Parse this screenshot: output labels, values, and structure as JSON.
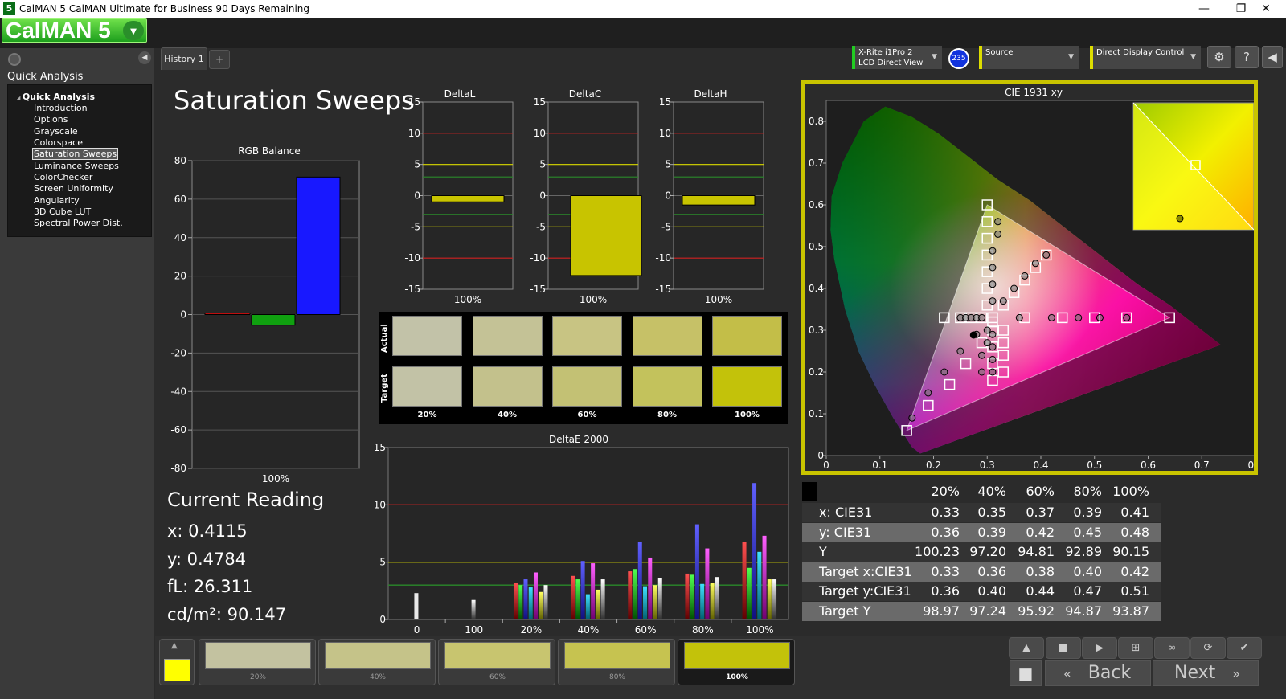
{
  "window": {
    "title": "CalMAN 5 CalMAN Ultimate for Business 90 Days Remaining",
    "app_icon": "5",
    "minimize_icon": "minimize-icon",
    "maximize_icon": "maximize-icon",
    "close_icon": "close-icon"
  },
  "logo": {
    "text": "CalMAN 5",
    "dropdown_glyph": "▾"
  },
  "left_panel": {
    "title": "Quick Analysis",
    "tree_root": "Quick Analysis",
    "items": [
      "Introduction",
      "Options",
      "Grayscale",
      "Colorspace",
      "Saturation Sweeps",
      "Luminance Sweeps",
      "ColorChecker",
      "Screen Uniformity",
      "Angularity",
      "3D Cube LUT",
      "Spectral Power Dist."
    ],
    "selected_index": 4
  },
  "tabs": {
    "history": "History 1",
    "add": "+"
  },
  "devices": {
    "meter_line1": "X-Rite i1Pro 2",
    "meter_line2": "LCD Direct View",
    "meter_badge": "235",
    "source": "Source",
    "display": "Direct Display Control",
    "meter_color": "#22cc22",
    "source_color": "#dddd00",
    "display_color": "#dddd00"
  },
  "page": {
    "title": "Saturation Sweeps"
  },
  "rgb_balance": {
    "title": "RGB Balance",
    "y_ticks": [
      "80",
      "60",
      "40",
      "20",
      "0",
      "-20",
      "-40",
      "-60",
      "-80"
    ],
    "x_label": "100%"
  },
  "delta_charts": {
    "y_ticks": [
      "15",
      "10",
      "5",
      "0",
      "-5",
      "-10",
      "-15"
    ],
    "x_label": "100%",
    "charts": [
      {
        "title": "DeltaL",
        "value": -1.0
      },
      {
        "title": "DeltaC",
        "value": -12.8
      },
      {
        "title": "DeltaH",
        "value": -1.5
      }
    ]
  },
  "swatches": {
    "actual_label": "Actual",
    "target_label": "Target",
    "labels": [
      "20%",
      "40%",
      "60%",
      "80%",
      "100%"
    ],
    "actual_colors": [
      "#c2c2a8",
      "#c4c296",
      "#c8c483",
      "#c6c167",
      "#c3be48"
    ],
    "target_colors": [
      "#c2c2a6",
      "#c3c18c",
      "#c3c174",
      "#c3c25c",
      "#c3c20a"
    ]
  },
  "deltae": {
    "title": "DeltaE 2000",
    "y_ticks": [
      "15",
      "10",
      "5",
      "0"
    ],
    "x_labels": [
      "0",
      "100",
      "20%",
      "40%",
      "60%",
      "80%",
      "100%"
    ]
  },
  "chart_data": [
    {
      "type": "bar",
      "title": "RGB Balance",
      "categories": [
        "100%"
      ],
      "series": [
        {
          "name": "Red",
          "values": [
            0.8
          ]
        },
        {
          "name": "Green",
          "values": [
            -5.5
          ]
        },
        {
          "name": "Blue",
          "values": [
            71.5
          ]
        }
      ],
      "ylim": [
        -80,
        80
      ]
    },
    {
      "type": "bar",
      "title": "DeltaL",
      "categories": [
        "100%"
      ],
      "values": [
        -1.0
      ],
      "ylim": [
        -15,
        15
      ]
    },
    {
      "type": "bar",
      "title": "DeltaC",
      "categories": [
        "100%"
      ],
      "values": [
        -12.8
      ],
      "ylim": [
        -15,
        15
      ]
    },
    {
      "type": "bar",
      "title": "DeltaH",
      "categories": [
        "100%"
      ],
      "values": [
        -1.5
      ],
      "ylim": [
        -15,
        15
      ]
    },
    {
      "type": "bar",
      "title": "DeltaE 2000",
      "categories": [
        "0",
        "100",
        "20%",
        "40%",
        "60%",
        "80%",
        "100%"
      ],
      "series": [
        {
          "name": "White",
          "values": [
            2.3,
            1.7,
            3.0,
            3.5,
            3.6,
            3.7,
            3.5
          ]
        },
        {
          "name": "Red",
          "values": [
            0,
            0,
            3.2,
            3.8,
            4.2,
            4.0,
            6.8
          ]
        },
        {
          "name": "Green",
          "values": [
            0,
            0,
            3.0,
            3.5,
            4.4,
            3.9,
            4.5
          ]
        },
        {
          "name": "Blue",
          "values": [
            0,
            0,
            3.5,
            5.1,
            6.8,
            8.3,
            11.9
          ]
        },
        {
          "name": "Cyan",
          "values": [
            0,
            0,
            2.8,
            2.2,
            2.9,
            3.1,
            5.9
          ]
        },
        {
          "name": "Magenta",
          "values": [
            0,
            0,
            4.1,
            4.9,
            5.4,
            6.2,
            7.3
          ]
        },
        {
          "name": "Yellow",
          "values": [
            0,
            0,
            2.4,
            2.6,
            3.0,
            3.2,
            3.5
          ]
        }
      ],
      "ylim": [
        0,
        15
      ],
      "reference_lines": [
        10,
        5,
        3
      ]
    },
    {
      "type": "scatter",
      "title": "CIE 1931 xy",
      "xlim": [
        0,
        0.8
      ],
      "ylim": [
        0,
        0.85
      ],
      "x_ticks": [
        "0",
        "0.1",
        "0.2",
        "0.3",
        "0.4",
        "0.5",
        "0.6",
        "0.7",
        "0.8"
      ],
      "y_ticks": [
        "0",
        "0.1",
        "0.2",
        "0.3",
        "0.4",
        "0.5",
        "0.6",
        "0.7",
        "0.8"
      ],
      "gamut": {
        "red": [
          0.64,
          0.33
        ],
        "green": [
          0.3,
          0.6
        ],
        "blue": [
          0.15,
          0.06
        ],
        "white": [
          0.3127,
          0.329
        ]
      },
      "targets": [
        [
          0.22,
          0.33
        ],
        [
          0.25,
          0.33
        ],
        [
          0.27,
          0.33
        ],
        [
          0.29,
          0.33
        ],
        [
          0.31,
          0.33
        ],
        [
          0.37,
          0.33
        ],
        [
          0.44,
          0.33
        ],
        [
          0.5,
          0.33
        ],
        [
          0.56,
          0.33
        ],
        [
          0.64,
          0.33
        ],
        [
          0.3,
          0.36
        ],
        [
          0.3,
          0.4
        ],
        [
          0.3,
          0.44
        ],
        [
          0.3,
          0.48
        ],
        [
          0.3,
          0.52
        ],
        [
          0.3,
          0.56
        ],
        [
          0.3,
          0.6
        ],
        [
          0.31,
          0.3
        ],
        [
          0.31,
          0.26
        ],
        [
          0.31,
          0.22
        ],
        [
          0.31,
          0.18
        ],
        [
          0.29,
          0.27
        ],
        [
          0.26,
          0.22
        ],
        [
          0.23,
          0.17
        ],
        [
          0.19,
          0.12
        ],
        [
          0.15,
          0.06
        ],
        [
          0.33,
          0.36
        ],
        [
          0.35,
          0.39
        ],
        [
          0.37,
          0.42
        ],
        [
          0.39,
          0.45
        ],
        [
          0.41,
          0.48
        ],
        [
          0.31,
          0.32
        ],
        [
          0.33,
          0.3
        ],
        [
          0.33,
          0.27
        ],
        [
          0.33,
          0.24
        ],
        [
          0.33,
          0.2
        ]
      ],
      "measured": [
        [
          0.25,
          0.33
        ],
        [
          0.26,
          0.33
        ],
        [
          0.27,
          0.33
        ],
        [
          0.28,
          0.33
        ],
        [
          0.29,
          0.33
        ],
        [
          0.36,
          0.33
        ],
        [
          0.42,
          0.33
        ],
        [
          0.47,
          0.33
        ],
        [
          0.51,
          0.33
        ],
        [
          0.56,
          0.33
        ],
        [
          0.31,
          0.37
        ],
        [
          0.31,
          0.41
        ],
        [
          0.31,
          0.45
        ],
        [
          0.31,
          0.49
        ],
        [
          0.32,
          0.53
        ],
        [
          0.32,
          0.56
        ],
        [
          0.3,
          0.3
        ],
        [
          0.3,
          0.27
        ],
        [
          0.29,
          0.24
        ],
        [
          0.29,
          0.2
        ],
        [
          0.28,
          0.29
        ],
        [
          0.25,
          0.25
        ],
        [
          0.22,
          0.2
        ],
        [
          0.19,
          0.15
        ],
        [
          0.16,
          0.09
        ],
        [
          0.33,
          0.37
        ],
        [
          0.35,
          0.4
        ],
        [
          0.37,
          0.43
        ],
        [
          0.39,
          0.46
        ],
        [
          0.41,
          0.48
        ],
        [
          0.31,
          0.29
        ],
        [
          0.31,
          0.26
        ],
        [
          0.31,
          0.23
        ],
        [
          0.31,
          0.2
        ]
      ],
      "current": [
        0.2746,
        0.2885
      ]
    }
  ],
  "cie": {
    "title": "CIE 1931 xy"
  },
  "current_reading": {
    "title": "Current Reading",
    "x": "x: 0.4115",
    "y": "y: 0.4784",
    "fl": "fL: 26.311",
    "cdm2": "cd/m²: 90.147"
  },
  "table": {
    "headers": [
      "20%",
      "40%",
      "60%",
      "80%",
      "100%"
    ],
    "rows": [
      {
        "label": "x: CIE31",
        "values": [
          "0.33",
          "0.35",
          "0.37",
          "0.39",
          "0.41"
        ]
      },
      {
        "label": "y: CIE31",
        "values": [
          "0.36",
          "0.39",
          "0.42",
          "0.45",
          "0.48"
        ]
      },
      {
        "label": "Y",
        "values": [
          "100.23",
          "97.20",
          "94.81",
          "92.89",
          "90.15"
        ]
      },
      {
        "label": "Target x:CIE31",
        "values": [
          "0.33",
          "0.36",
          "0.38",
          "0.40",
          "0.42"
        ]
      },
      {
        "label": "Target y:CIE31",
        "values": [
          "0.36",
          "0.40",
          "0.44",
          "0.47",
          "0.51"
        ]
      },
      {
        "label": "Target Y",
        "values": [
          "98.97",
          "97.24",
          "95.92",
          "94.87",
          "93.87"
        ]
      }
    ]
  },
  "bottom": {
    "current_color": "#ffff00",
    "swatch_labels": [
      "20%",
      "40%",
      "60%",
      "80%",
      "100%"
    ],
    "swatch_colors": [
      "#c3c2a0",
      "#c5c389",
      "#c8c56f",
      "#c6c350",
      "#c3c20a"
    ],
    "back": "Back",
    "next": "Next"
  }
}
